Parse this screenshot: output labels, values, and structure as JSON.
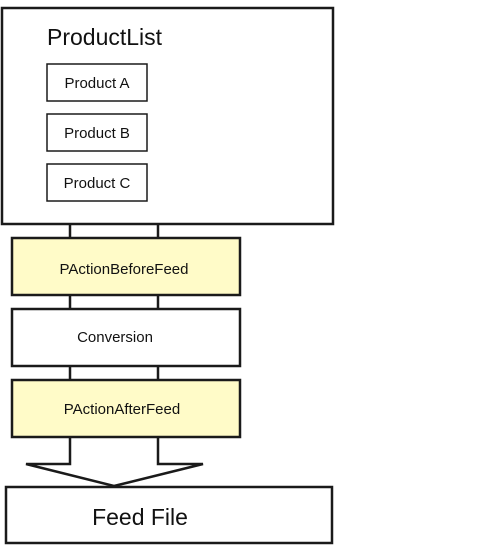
{
  "diagram": {
    "container": {
      "label": "ProductList",
      "items": [
        "Product A",
        "Product B",
        "Product C"
      ]
    },
    "steps": [
      {
        "label": "PActionBeforeFeed",
        "highlighted": true
      },
      {
        "label": "Conversion",
        "highlighted": false
      },
      {
        "label": "PActionAfterFeed",
        "highlighted": true
      }
    ],
    "output": {
      "label": "Feed File"
    },
    "colors": {
      "highlight": "#fffbc8",
      "stroke": "#1a1a1a",
      "plain": "#ffffff"
    }
  }
}
